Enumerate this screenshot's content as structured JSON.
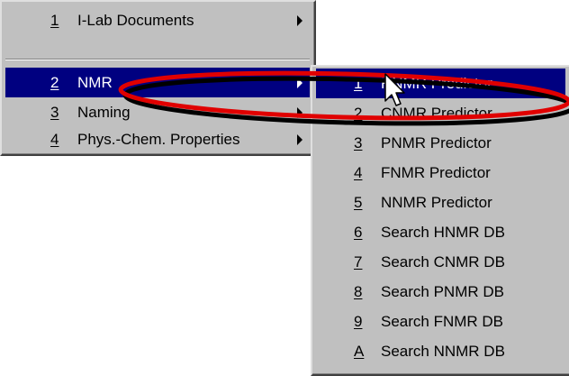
{
  "main_menu": {
    "items": [
      {
        "mnemonic": "1",
        "label": "I-Lab Documents"
      },
      {
        "mnemonic": "2",
        "label": "NMR"
      },
      {
        "mnemonic": "3",
        "label": "Naming"
      },
      {
        "mnemonic": "4",
        "label": "Phys.-Chem. Properties"
      }
    ],
    "active_item": "NMR"
  },
  "sub_menu": {
    "items": [
      {
        "mnemonic": "1",
        "label": "HNMR Predictor"
      },
      {
        "mnemonic": "2",
        "label": "CNMR Predictor"
      },
      {
        "mnemonic": "3",
        "label": "PNMR Predictor"
      },
      {
        "mnemonic": "4",
        "label": "FNMR Predictor"
      },
      {
        "mnemonic": "5",
        "label": "NNMR Predictor"
      },
      {
        "mnemonic": "6",
        "label": "Search HNMR DB"
      },
      {
        "mnemonic": "7",
        "label": "Search CNMR DB"
      },
      {
        "mnemonic": "8",
        "label": "Search PNMR DB"
      },
      {
        "mnemonic": "9",
        "label": "Search FNMR DB"
      },
      {
        "mnemonic": "A",
        "label": "Search NNMR DB"
      }
    ],
    "active_item": "HNMR Predictor"
  },
  "colors": {
    "menu_bg": "#c0c0c0",
    "highlight": "#000080",
    "highlight_text": "#ffffff",
    "annotation_ellipse": "#e00000"
  }
}
